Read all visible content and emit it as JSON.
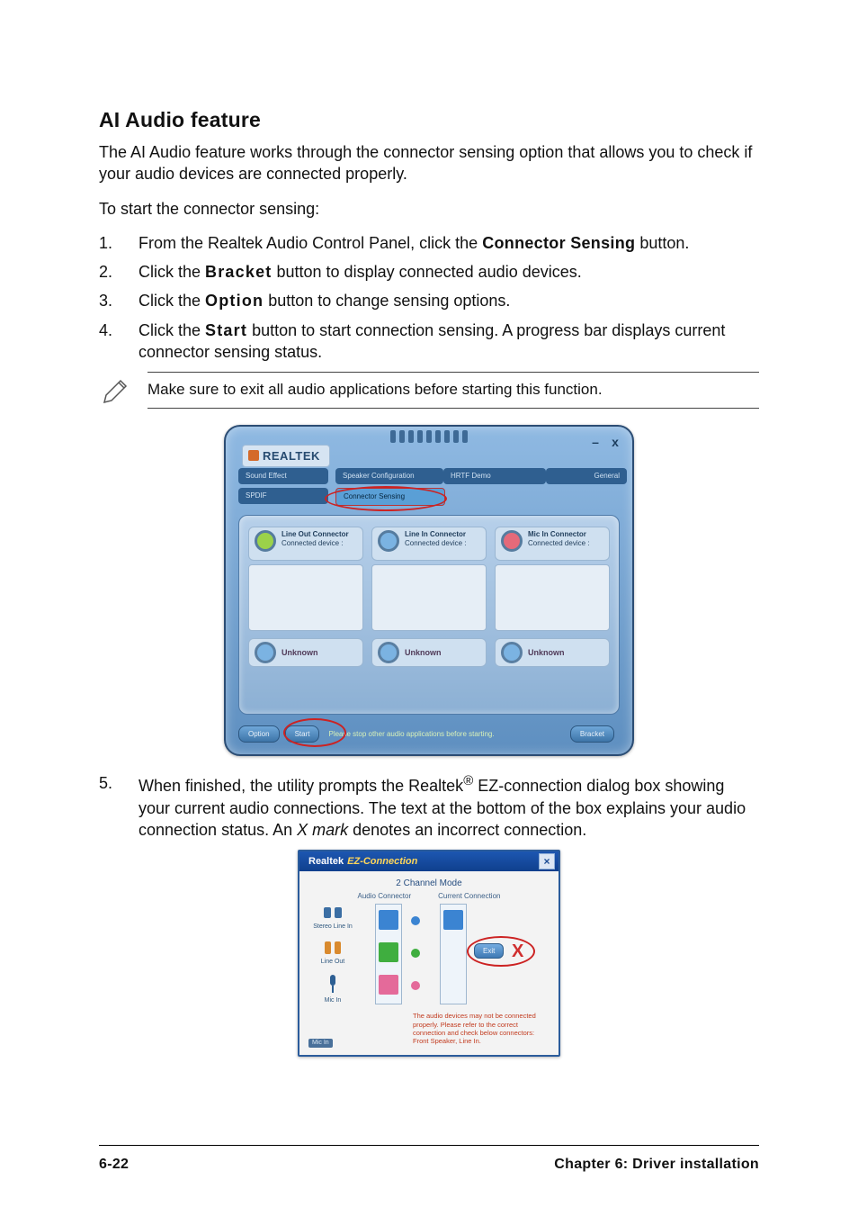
{
  "heading": "AI Audio feature",
  "intro": "The AI Audio feature works through the connector sensing option that allows you to check if your audio devices are connected properly.",
  "lead_in": "To start the connector sensing:",
  "steps": {
    "1": {
      "pre": "From the Realtek Audio Control Panel, click the ",
      "bold": "Connector Sensing",
      "post": " button."
    },
    "2": {
      "pre": "Click the ",
      "bold": "Bracket",
      "post": " button to display connected audio devices."
    },
    "3": {
      "pre": "Click the ",
      "bold": "Option",
      "post": " button to change sensing options."
    },
    "4": {
      "pre": "Click the ",
      "bold": "Start",
      "post": " button to start connection sensing. A progress bar displays current connector sensing status."
    },
    "5": {
      "pre": "When finished, the utility prompts the Realtek",
      "sup": "®",
      "mid": " EZ-connection dialog box showing your current audio connections. The text at the bottom of the box explains your audio connection status. An ",
      "italic": "X mark",
      "post": " denotes an incorrect connection."
    }
  },
  "note": "Make sure to exit all audio applications before starting this function.",
  "realtek_panel": {
    "brand": "REALTEK",
    "tabs": {
      "sound_effect": "Sound Effect",
      "speaker_config": "Speaker Configuration",
      "hrtf_demo": "HRTF Demo",
      "general": "General",
      "spdif": "SPDIF",
      "connector_sensing": "Connector Sensing"
    },
    "connectors": {
      "line_out": {
        "title": "Line Out Connector",
        "sub": "Connected device :"
      },
      "line_in": {
        "title": "Line In Connector",
        "sub": "Connected device :"
      },
      "mic_in": {
        "title": "Mic In Connector",
        "sub": "Connected device :"
      }
    },
    "unknown_label": "Unknown",
    "buttons": {
      "option": "Option",
      "start": "Start",
      "bracket": "Bracket"
    },
    "message": "Please stop other audio applications before starting.",
    "win": {
      "min": "–",
      "close": "x"
    }
  },
  "ez_dialog": {
    "title_brand": "Realtek",
    "title_ez": "EZ-Connection",
    "close": "×",
    "mode": "2 Channel Mode",
    "col_audio": "Audio Connector",
    "col_current": "Current Connection",
    "left_items": {
      "stereo_line_in": "Stereo Line In",
      "line_out": "Line Out",
      "mic_in": "Mic In"
    },
    "exit_btn": "Exit",
    "x_mark": "X",
    "warning": "The audio devices may not be connected properly. Please refer to the correct connection and check below connectors: Front Speaker, Line In."
  },
  "footer": {
    "left": "6-22",
    "right": "Chapter 6: Driver installation"
  }
}
